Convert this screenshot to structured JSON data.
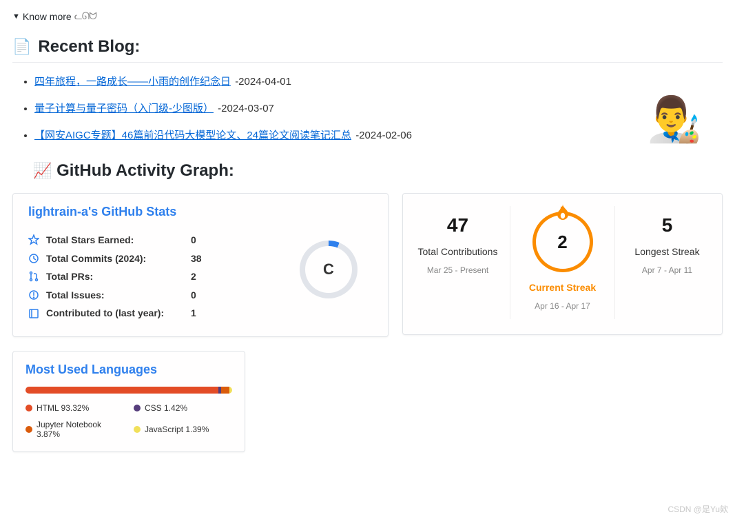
{
  "know_more": "Know more",
  "recent_blog_heading": "Recent Blog:",
  "blog_posts": [
    {
      "title": "四年旅程，一路成长——小雨的创作纪念日",
      "date": "-2024-04-01"
    },
    {
      "title": "量子计算与量子密码（入门级-少图版）",
      "date": "-2024-03-07"
    },
    {
      "title": "【网安AIGC专题】46篇前沿代码大模型论文、24篇论文阅读笔记汇总",
      "date": "-2024-02-06"
    }
  ],
  "activity_heading": "GitHub Activity Graph:",
  "stats": {
    "title": "lightrain-a's GitHub Stats",
    "rows": [
      {
        "label": "Total Stars Earned:",
        "value": "0"
      },
      {
        "label": "Total Commits (2024):",
        "value": "38"
      },
      {
        "label": "Total PRs:",
        "value": "2"
      },
      {
        "label": "Total Issues:",
        "value": "0"
      },
      {
        "label": "Contributed to (last year):",
        "value": "1"
      }
    ],
    "grade": "C"
  },
  "streak": {
    "total": {
      "num": "47",
      "label": "Total Contributions",
      "sub": "Mar 25 - Present"
    },
    "current": {
      "num": "2",
      "label": "Current Streak",
      "sub": "Apr 16 - Apr 17"
    },
    "longest": {
      "num": "5",
      "label": "Longest Streak",
      "sub": "Apr 7 - Apr 11"
    }
  },
  "languages": {
    "title": "Most Used Languages",
    "items": [
      {
        "name": "HTML 93.32%",
        "color": "#e34c26",
        "pct": 93.32
      },
      {
        "name": "CSS 1.42%",
        "color": "#563d7c",
        "pct": 1.42
      },
      {
        "name": "Jupyter Notebook 3.87%",
        "color": "#DA5B0B",
        "pct": 3.87
      },
      {
        "name": "JavaScript 1.39%",
        "color": "#f1e05a",
        "pct": 1.39
      }
    ]
  },
  "watermark": "CSDN @是Yu欸",
  "icons": {
    "document": "📄",
    "chart": "📈",
    "artist": "👨‍🎨"
  }
}
